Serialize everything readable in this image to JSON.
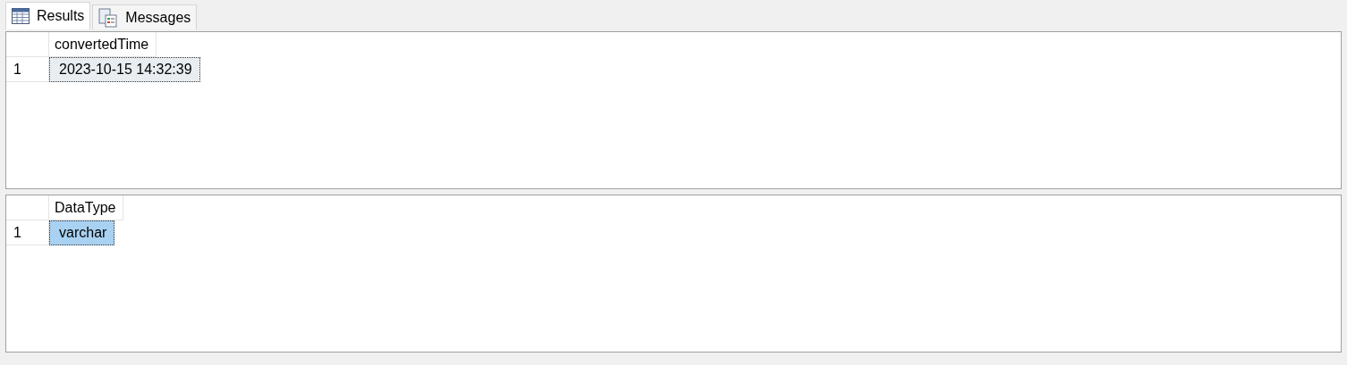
{
  "tabs": [
    {
      "label": "Results",
      "kind": "grid",
      "selected": true
    },
    {
      "label": "Messages",
      "kind": "messages",
      "selected": false
    }
  ],
  "grids": [
    {
      "active": false,
      "columns": [
        "convertedTime"
      ],
      "rows": [
        {
          "number": "1",
          "cells": [
            {
              "value": "2023-10-15 14:32:39",
              "selected": true
            }
          ]
        }
      ]
    },
    {
      "active": true,
      "columns": [
        "DataType"
      ],
      "rows": [
        {
          "number": "1",
          "cells": [
            {
              "value": "varchar",
              "selected": true
            }
          ]
        }
      ]
    }
  ]
}
